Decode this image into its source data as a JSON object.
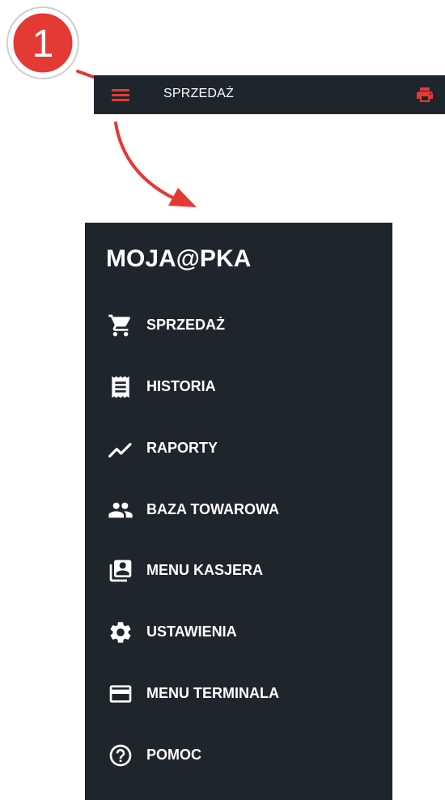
{
  "callout": {
    "number": "1",
    "color": "#e53935"
  },
  "topbar": {
    "title": "SPRZEDAŻ",
    "menu_icon": "hamburger-icon",
    "print_icon": "printer-icon",
    "accent": "#e53935",
    "background": "#1f252d"
  },
  "drawer": {
    "title": "MOJA@PKA",
    "background": "#1f252d",
    "items": [
      {
        "label": "SPRZEDAŻ",
        "icon": "cart-icon"
      },
      {
        "label": "HISTORIA",
        "icon": "receipt-icon"
      },
      {
        "label": "RAPORTY",
        "icon": "trending-up-icon"
      },
      {
        "label": "BAZA TOWAROWA",
        "icon": "people-icon"
      },
      {
        "label": "MENU KASJERA",
        "icon": "cashier-card-icon"
      },
      {
        "label": "USTAWIENIA",
        "icon": "gear-icon"
      },
      {
        "label": "MENU TERMINALA",
        "icon": "credit-card-icon"
      },
      {
        "label": "POMOC",
        "icon": "help-circle-icon"
      }
    ]
  }
}
